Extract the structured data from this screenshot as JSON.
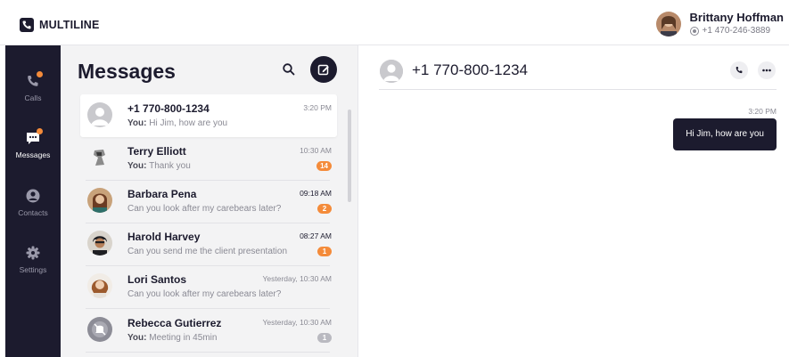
{
  "app": {
    "brand": "MULTILINE",
    "brand_color": "#1c1b2e",
    "accent": "#f48b3a"
  },
  "user": {
    "name": "Brittany Hoffman",
    "phone": "+1 470-246-3889"
  },
  "nav": [
    {
      "label": "Calls",
      "icon": "phone-icon",
      "has_dot": true
    },
    {
      "label": "Messages",
      "icon": "chat-icon",
      "has_dot": true,
      "active": true
    },
    {
      "label": "Contacts",
      "icon": "person-icon"
    },
    {
      "label": "Settings",
      "icon": "gear-icon"
    }
  ],
  "list": {
    "title": "Messages",
    "conversations": [
      {
        "name": "+1 770-800-1234",
        "time": "3:20 PM",
        "prefix": "You:",
        "preview": "Hi Jim, how are you",
        "active": true
      },
      {
        "name": "Terry Elliott",
        "time": "10:30 AM",
        "prefix": "You:",
        "preview": "Thank you",
        "badge": "14"
      },
      {
        "name": "Barbara Pena",
        "time": "09:18 AM",
        "prefix": "",
        "preview": "Can you look after my carebears later?",
        "badge": "2"
      },
      {
        "name": "Harold Harvey",
        "time": "08:27 AM",
        "prefix": "",
        "preview": "Can you send me the client presentation",
        "badge": "1"
      },
      {
        "name": "Lori Santos",
        "time": "Yesterday, 10:30 AM",
        "prefix": "",
        "preview": "Can you look after my carebears later?"
      },
      {
        "name": "Rebecca Gutierrez",
        "time": "Yesterday, 10:30 AM",
        "prefix": "You:",
        "preview": "Meeting in 45min",
        "badge": "1"
      }
    ]
  },
  "chat": {
    "number": "+1 770-800-1234",
    "messages": [
      {
        "time": "3:20 PM",
        "text": "Hi Jim, how are you",
        "outgoing": true
      }
    ]
  }
}
